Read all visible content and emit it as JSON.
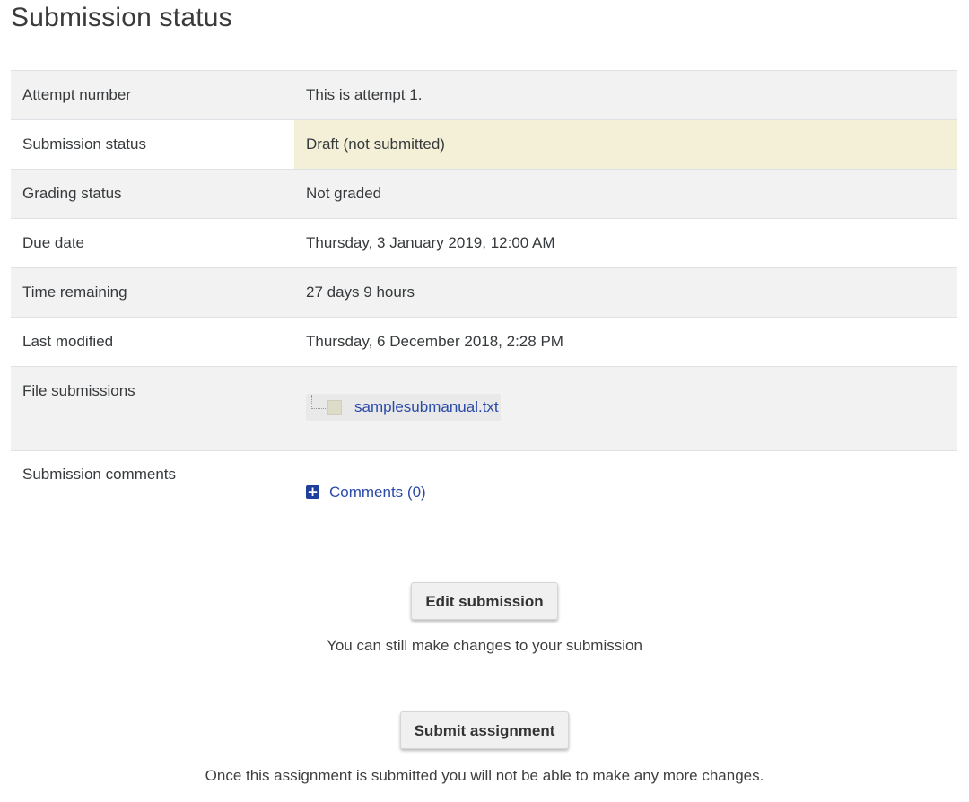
{
  "page": {
    "title": "Submission status"
  },
  "rows": [
    {
      "label": "Attempt number",
      "value": "This is attempt 1."
    },
    {
      "label": "Submission status",
      "value": "Draft (not submitted)"
    },
    {
      "label": "Grading status",
      "value": "Not graded"
    },
    {
      "label": "Due date",
      "value": "Thursday, 3 January 2019, 12:00 AM"
    },
    {
      "label": "Time remaining",
      "value": "27 days 9 hours"
    },
    {
      "label": "Last modified",
      "value": "Thursday, 6 December 2018, 2:28 PM"
    },
    {
      "label": "File submissions",
      "file_name": "samplesubmanual.txt"
    },
    {
      "label": "Submission comments",
      "link": "Comments (0)"
    }
  ],
  "actions": {
    "edit_label": "Edit submission",
    "edit_help": "You can still make changes to your submission",
    "submit_label": "Submit assignment",
    "submit_help": "Once this assignment is submitted you will not be able to make any more changes."
  },
  "icons": {
    "file": "file-icon",
    "comments_toggle": "plus-square-icon"
  },
  "colors": {
    "link": "#2a4aa8",
    "draft_highlight": "#f3f0d7",
    "row_alt": "#f2f2f2"
  }
}
